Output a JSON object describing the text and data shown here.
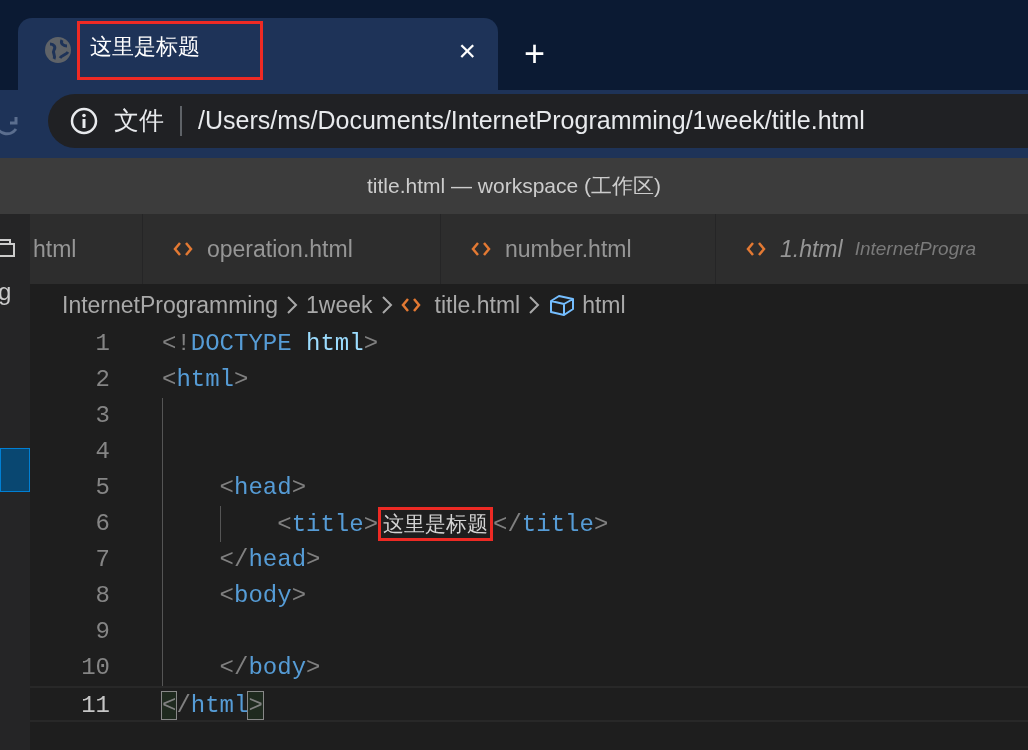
{
  "browser": {
    "tab": {
      "title": "这里是标题",
      "highlighted": true,
      "close": "×"
    },
    "new_tab": "+",
    "address": {
      "scheme": "文件",
      "url": "/Users/ms/Documents/InternetProgramming/1week/title.html"
    }
  },
  "window": {
    "title": "title.html — workspace (工作区)"
  },
  "sidebar": {
    "items": [
      {
        "kind": "icon",
        "selected": false
      },
      {
        "kind": "text",
        "text": "g",
        "selected": false
      },
      {
        "kind": "blank",
        "selected": true
      }
    ]
  },
  "tabs": [
    {
      "label": "html",
      "icon": false,
      "preview": false,
      "selected": false
    },
    {
      "label": "operation.html",
      "icon": true,
      "preview": false,
      "selected": false
    },
    {
      "label": "number.html",
      "icon": true,
      "preview": false,
      "selected": false
    },
    {
      "label": "1.html",
      "description": "InternetProgra",
      "icon": true,
      "preview": true,
      "selected": false
    }
  ],
  "breadcrumb": [
    {
      "label": "InternetProgramming",
      "kind": "folder"
    },
    {
      "label": "1week",
      "kind": "folder"
    },
    {
      "label": "title.html",
      "kind": "file"
    },
    {
      "label": "html",
      "kind": "element"
    }
  ],
  "code": [
    {
      "number": "1",
      "current": false,
      "tokens": [
        {
          "kind": "punct",
          "text": "<!"
        },
        {
          "kind": "tag",
          "text": "DOCTYPE"
        },
        {
          "kind": "attr",
          "text": "html"
        },
        {
          "kind": "punct",
          "text": ">"
        }
      ]
    },
    {
      "number": "2",
      "current": false,
      "tokens": [
        {
          "kind": "punct",
          "text": "<"
        },
        {
          "kind": "tag",
          "text": "html"
        },
        {
          "kind": "punct",
          "text": ">"
        }
      ],
      "children": [
        {
          "number": "3",
          "current": false
        },
        {
          "number": "4",
          "current": false
        },
        {
          "number": "5",
          "current": false,
          "tokens": [
            {
              "kind": "punct",
              "text": "<"
            },
            {
              "kind": "tag",
              "text": "head"
            },
            {
              "kind": "punct",
              "text": ">"
            }
          ],
          "children": [
            {
              "number": "6",
              "current": false,
              "tokens": [
                {
                  "kind": "punct",
                  "text": "<"
                },
                {
                  "kind": "tag",
                  "text": "title"
                },
                {
                  "kind": "punct",
                  "text": ">"
                },
                {
                  "kind": "text",
                  "text": "这里是标题",
                  "highlighted": true
                },
                {
                  "kind": "punct",
                  "text": "</"
                },
                {
                  "kind": "tag",
                  "text": "title"
                },
                {
                  "kind": "punct",
                  "text": ">"
                }
              ]
            }
          ]
        },
        {
          "number": "7",
          "current": false,
          "tokens": [
            {
              "kind": "punct",
              "text": "</"
            },
            {
              "kind": "tag",
              "text": "head"
            },
            {
              "kind": "punct",
              "text": ">"
            }
          ]
        },
        {
          "number": "8",
          "current": false,
          "tokens": [
            {
              "kind": "punct",
              "text": "<"
            },
            {
              "kind": "tag",
              "text": "body"
            },
            {
              "kind": "punct",
              "text": ">"
            }
          ]
        },
        {
          "number": "9",
          "current": false
        },
        {
          "number": "10",
          "current": false,
          "tokens": [
            {
              "kind": "punct",
              "text": "</"
            },
            {
              "kind": "tag",
              "text": "body"
            },
            {
              "kind": "punct",
              "text": ">"
            }
          ]
        }
      ]
    },
    {
      "number": "11",
      "current": true,
      "tokens": [
        {
          "kind": "punct",
          "text": "<",
          "matched": true
        },
        {
          "kind": "punct",
          "text": "/"
        },
        {
          "kind": "tag",
          "text": "html"
        },
        {
          "kind": "punct",
          "text": ">",
          "matched": true
        }
      ]
    }
  ]
}
